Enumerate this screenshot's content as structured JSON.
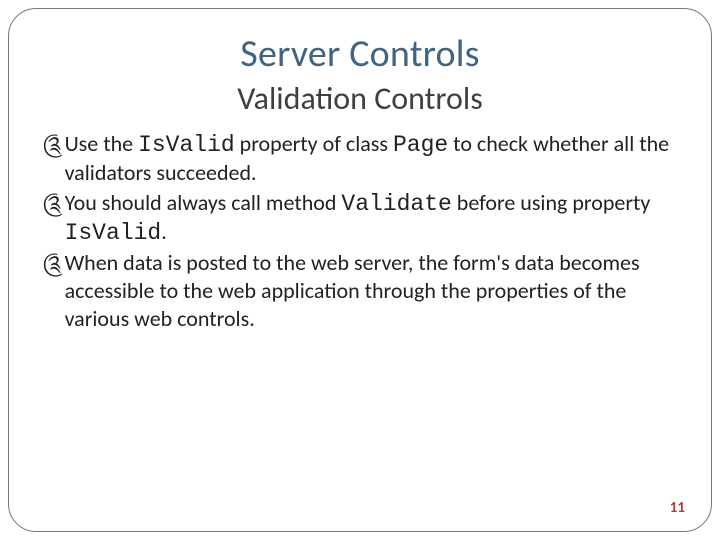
{
  "title": "Server Controls",
  "subtitle": "Validation Controls",
  "bullets": [
    {
      "pre": "Use the ",
      "code1": "IsValid",
      "mid1": " property of class ",
      "code2": "Page",
      "mid2": " to check whether all the validators succeeded."
    },
    {
      "pre": "You should always call method ",
      "code1": "Validate",
      "mid1": " before using property ",
      "code2": "IsValid",
      "mid2": "."
    },
    {
      "pre": "When data is posted to the web server, the form's data becomes accessible to the web application through the properties of the various web controls."
    }
  ],
  "page_number": "11",
  "bullet_glyph": "༊"
}
